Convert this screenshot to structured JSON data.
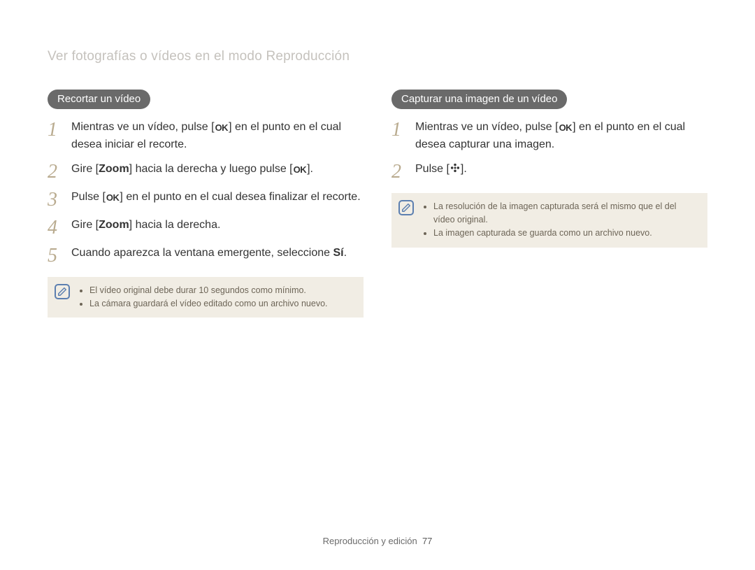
{
  "breadcrumb": "Ver fotografías o vídeos en el modo Reproducción",
  "left": {
    "heading": "Recortar un vídeo",
    "steps": {
      "s1_a": "Mientras ve un vídeo, pulse [",
      "s1_b": "] en el punto en el cual desea iniciar el recorte.",
      "s2_a": "Gire [",
      "s2_zoom": "Zoom",
      "s2_b": "] hacia la derecha y luego pulse [",
      "s2_c": "].",
      "s3_a": "Pulse [",
      "s3_b": "] en el punto en el cual desea finalizar el recorte.",
      "s4_a": "Gire [",
      "s4_zoom": "Zoom",
      "s4_b": "] hacia la derecha.",
      "s5_a": "Cuando aparezca la ventana emergente, seleccione ",
      "s5_si": "Sí",
      "s5_b": "."
    },
    "notes": [
      "El vídeo original debe durar 10 segundos como mínimo.",
      "La cámara guardará el vídeo editado como un archivo nuevo."
    ]
  },
  "right": {
    "heading": "Capturar una imagen de un vídeo",
    "steps": {
      "s1_a": "Mientras ve un vídeo, pulse [",
      "s1_b": "] en el punto en el cual desea capturar una imagen.",
      "s2_a": "Pulse [",
      "s2_b": "]."
    },
    "notes": [
      "La resolución de la imagen capturada será el mismo que el del vídeo original.",
      "La imagen capturada se guarda como un archivo nuevo."
    ]
  },
  "nums": {
    "n1": "1",
    "n2": "2",
    "n3": "3",
    "n4": "4",
    "n5": "5"
  },
  "ok_label": "OK",
  "footer": {
    "section": "Reproducción y edición",
    "page": "77"
  }
}
